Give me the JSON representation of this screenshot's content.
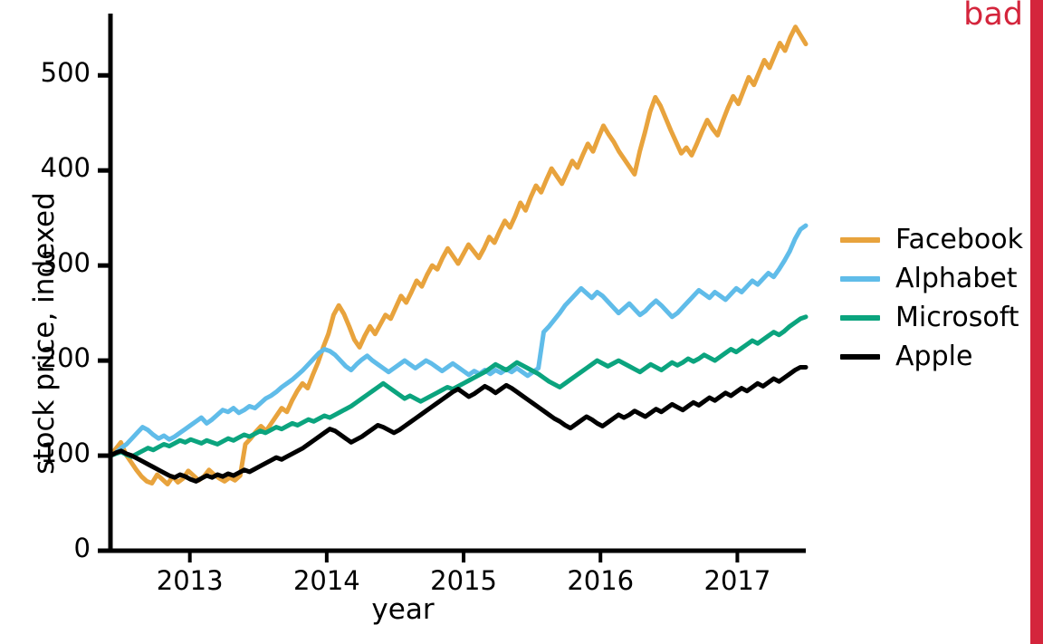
{
  "annotation": {
    "label": "bad",
    "color": "#D4253C",
    "bar_color": "#D4253C"
  },
  "legend": {
    "position": "right",
    "entries": [
      {
        "label": "Facebook",
        "color": "#E8A33D"
      },
      {
        "label": "Alphabet",
        "color": "#60BCE9"
      },
      {
        "label": "Microsoft",
        "color": "#0BA47E"
      },
      {
        "label": "Apple",
        "color": "#000000"
      }
    ]
  },
  "chart_data": {
    "type": "line",
    "title": "",
    "xlabel": "year",
    "ylabel": "stock price, indexed",
    "xlim": [
      2012.42,
      2017.5
    ],
    "ylim": [
      0,
      565
    ],
    "yticks": [
      0,
      100,
      200,
      300,
      400,
      500
    ],
    "xticks": [
      2013,
      2014,
      2015,
      2016,
      2017
    ],
    "ytick_labels": [
      "0",
      "100",
      "200",
      "300",
      "400",
      "500"
    ],
    "xtick_labels": [
      "2013",
      "2014",
      "2015",
      "2016",
      "2017"
    ],
    "grid": false,
    "index_base": 100,
    "x_step": 0.042,
    "series": [
      {
        "name": "Facebook",
        "color": "#E8A33D",
        "values": [
          100,
          107,
          114,
          101,
          93,
          85,
          78,
          73,
          71,
          80,
          75,
          70,
          78,
          72,
          76,
          84,
          79,
          74,
          78,
          85,
          80,
          76,
          73,
          77,
          74,
          79,
          112,
          118,
          125,
          131,
          126,
          134,
          142,
          150,
          146,
          158,
          168,
          176,
          171,
          185,
          198,
          214,
          228,
          248,
          258,
          249,
          236,
          222,
          214,
          226,
          236,
          228,
          238,
          248,
          244,
          256,
          268,
          261,
          272,
          284,
          278,
          290,
          300,
          296,
          308,
          318,
          310,
          302,
          312,
          322,
          315,
          308,
          318,
          330,
          324,
          336,
          347,
          340,
          352,
          366,
          358,
          372,
          384,
          377,
          390,
          402,
          394,
          386,
          398,
          410,
          403,
          416,
          428,
          420,
          434,
          447,
          438,
          430,
          420,
          412,
          404,
          396,
          420,
          440,
          462,
          477,
          468,
          455,
          442,
          430,
          418,
          424,
          416,
          428,
          441,
          453,
          444,
          437,
          452,
          466,
          478,
          470,
          484,
          498,
          490,
          503,
          516,
          508,
          521,
          534,
          526,
          540,
          551,
          542,
          533
        ]
      },
      {
        "name": "Alphabet",
        "color": "#60BCE9",
        "values": [
          100,
          103,
          108,
          112,
          118,
          124,
          130,
          127,
          122,
          118,
          121,
          117,
          120,
          124,
          128,
          132,
          136,
          140,
          134,
          138,
          143,
          148,
          146,
          150,
          145,
          148,
          152,
          150,
          155,
          160,
          163,
          167,
          172,
          176,
          180,
          185,
          190,
          196,
          202,
          208,
          212,
          210,
          206,
          200,
          194,
          190,
          196,
          201,
          205,
          200,
          196,
          192,
          188,
          192,
          196,
          200,
          196,
          192,
          196,
          200,
          197,
          193,
          189,
          193,
          197,
          193,
          189,
          185,
          189,
          186,
          190,
          186,
          190,
          187,
          191,
          188,
          192,
          188,
          184,
          188,
          192,
          230,
          236,
          243,
          250,
          258,
          264,
          270,
          276,
          271,
          266,
          272,
          268,
          262,
          256,
          250,
          255,
          260,
          254,
          248,
          252,
          258,
          263,
          258,
          252,
          246,
          250,
          256,
          262,
          268,
          274,
          270,
          266,
          272,
          268,
          264,
          270,
          276,
          272,
          278,
          284,
          280,
          286,
          292,
          288,
          296,
          305,
          315,
          328,
          338,
          342
        ]
      },
      {
        "name": "Microsoft",
        "color": "#0BA47E",
        "values": [
          100,
          102,
          104,
          101,
          99,
          102,
          105,
          108,
          106,
          109,
          112,
          110,
          113,
          116,
          114,
          117,
          115,
          113,
          116,
          114,
          112,
          115,
          118,
          116,
          119,
          122,
          120,
          123,
          126,
          124,
          127,
          130,
          128,
          131,
          134,
          132,
          135,
          138,
          136,
          139,
          142,
          140,
          143,
          146,
          149,
          152,
          156,
          160,
          164,
          168,
          172,
          176,
          172,
          168,
          164,
          160,
          163,
          160,
          157,
          160,
          163,
          166,
          169,
          172,
          170,
          173,
          176,
          179,
          182,
          185,
          188,
          192,
          196,
          193,
          190,
          194,
          198,
          195,
          192,
          189,
          186,
          182,
          178,
          175,
          172,
          176,
          180,
          184,
          188,
          192,
          196,
          200,
          197,
          194,
          197,
          200,
          197,
          194,
          191,
          188,
          192,
          196,
          193,
          190,
          194,
          198,
          195,
          198,
          202,
          199,
          202,
          206,
          203,
          200,
          204,
          208,
          212,
          209,
          213,
          217,
          221,
          218,
          222,
          226,
          230,
          227,
          231,
          236,
          240,
          244,
          246
        ]
      },
      {
        "name": "Apple",
        "color": "#000000",
        "values": [
          100,
          103,
          105,
          102,
          100,
          97,
          94,
          91,
          88,
          85,
          82,
          79,
          77,
          80,
          78,
          75,
          73,
          76,
          79,
          77,
          80,
          78,
          81,
          79,
          82,
          85,
          83,
          86,
          89,
          92,
          95,
          98,
          96,
          99,
          102,
          105,
          108,
          112,
          116,
          120,
          124,
          128,
          126,
          122,
          118,
          114,
          117,
          120,
          124,
          128,
          132,
          130,
          127,
          124,
          127,
          131,
          135,
          139,
          143,
          147,
          151,
          155,
          159,
          163,
          167,
          170,
          166,
          162,
          165,
          169,
          173,
          170,
          166,
          170,
          174,
          171,
          167,
          163,
          159,
          155,
          151,
          147,
          143,
          139,
          136,
          132,
          129,
          133,
          137,
          141,
          138,
          134,
          131,
          135,
          139,
          143,
          140,
          143,
          147,
          144,
          141,
          145,
          149,
          146,
          150,
          154,
          151,
          148,
          152,
          156,
          153,
          157,
          161,
          158,
          162,
          166,
          163,
          167,
          171,
          168,
          172,
          176,
          173,
          177,
          181,
          178,
          182,
          186,
          190,
          193,
          193
        ]
      }
    ]
  }
}
